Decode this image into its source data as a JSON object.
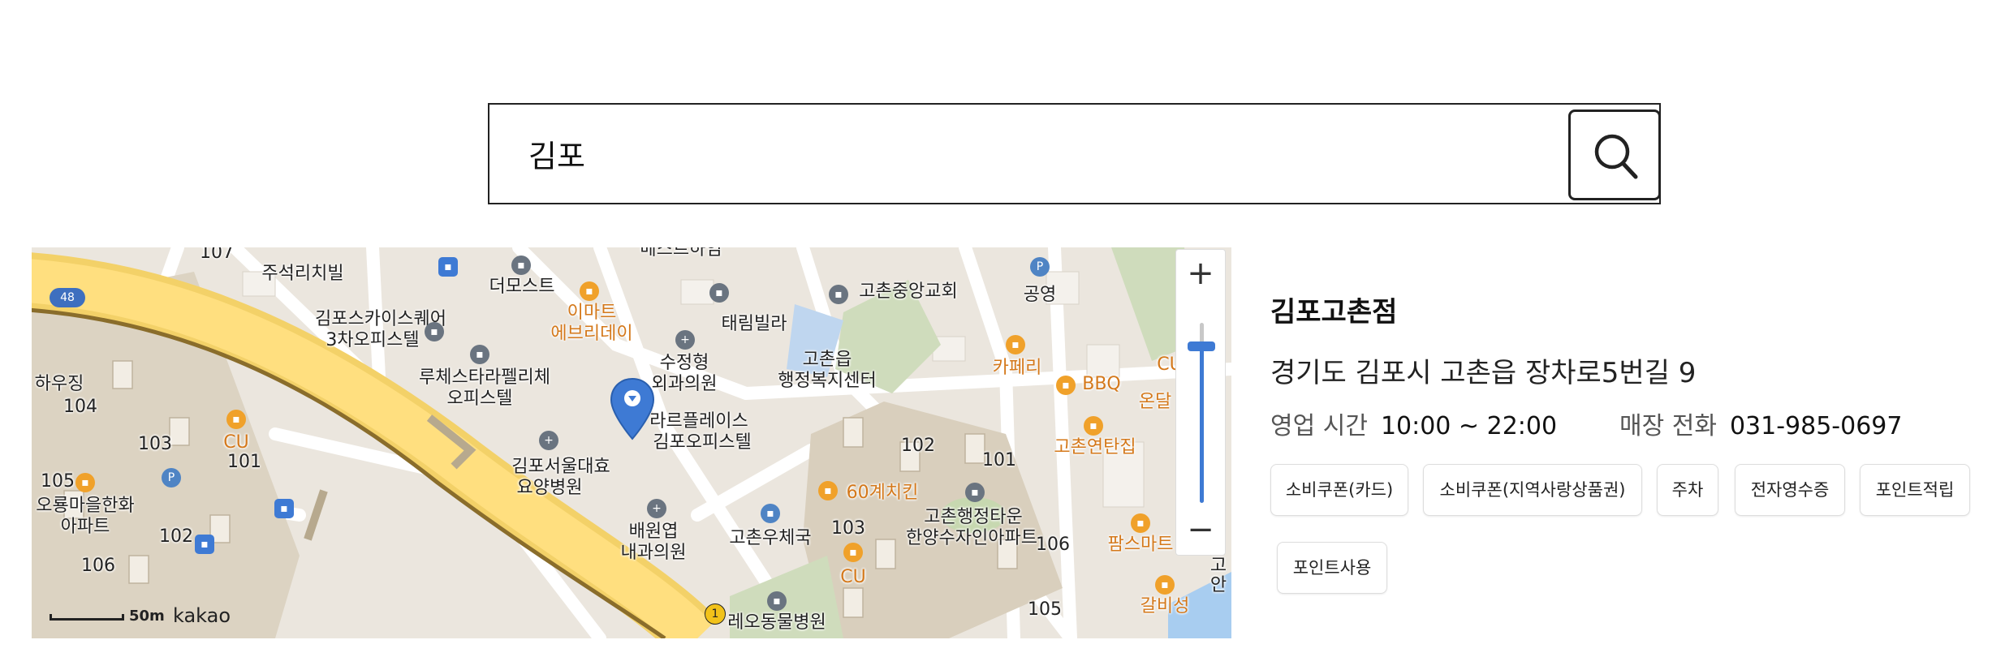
{
  "search": {
    "value": "김포",
    "placeholder": ""
  },
  "map": {
    "labels": [
      "107",
      "주석리치빌",
      "더모스트",
      "메스트하임",
      "이마트",
      "에브리데이",
      "김포스카이스퀘어",
      "3차오피스텔",
      "루체스타라펠리체",
      "오피스텔",
      "수정형",
      "외과의원",
      "태림빌라",
      "고촌중앙교회",
      "고촌읍",
      "행정복지센터",
      "공영",
      "카페리",
      "BBQ",
      "CU",
      "온달",
      "하우징",
      "104",
      "103",
      "CU",
      "101",
      "105",
      "오룡마을한화",
      "아파트",
      "102",
      "106",
      "라르플레이스",
      "김포오피스텔",
      "김포서울대효",
      "요양병원",
      "배원엽",
      "내과의원",
      "고촌우체국",
      "60계치킨",
      "102",
      "101",
      "103",
      "고촌행정타운",
      "한양수자인아파트",
      "CU",
      "106",
      "고촌연탄집",
      "팜스마트",
      "105",
      "갈비성",
      "레오동물병원",
      "48",
      "1",
      "고",
      "안"
    ],
    "scale_label": "50m",
    "logo": "kakao",
    "zoom_in": "+",
    "zoom_out": "−",
    "zoom_level": 0.87
  },
  "store": {
    "name": "김포고촌점",
    "address": "경기도 김포시 고촌읍 장차로5번길 9",
    "hours_label": "영업 시간",
    "hours_value": "10:00 ~ 22:00",
    "phone_label": "매장 전화",
    "phone_value": "031-985-0697",
    "tags": [
      "소비쿠폰(카드)",
      "소비쿠폰(지역사랑상품권)",
      "주차",
      "전자영수증",
      "포인트적립",
      "포인트사용"
    ]
  }
}
